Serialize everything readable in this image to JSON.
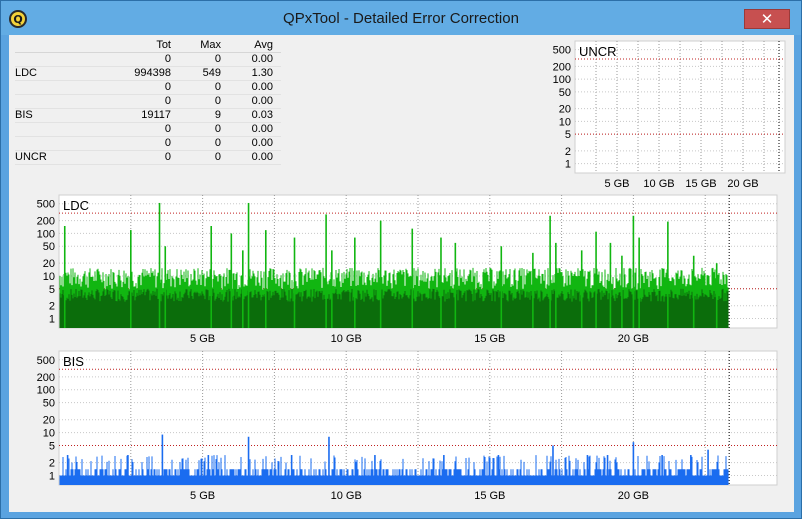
{
  "window": {
    "title": "QPxTool - Detailed Error Correction",
    "close_glyph": "✕",
    "icon": "Q"
  },
  "stats": {
    "headers": {
      "name": "",
      "tot": "Tot",
      "max": "Max",
      "avg": "Avg"
    },
    "rows": [
      {
        "name": "",
        "tot": "0",
        "max": "0",
        "avg": "0.00"
      },
      {
        "name": "LDC",
        "tot": "994398",
        "max": "549",
        "avg": "1.30"
      },
      {
        "name": "",
        "tot": "0",
        "max": "0",
        "avg": "0.00"
      },
      {
        "name": "",
        "tot": "0",
        "max": "0",
        "avg": "0.00"
      },
      {
        "name": "BIS",
        "tot": "19117",
        "max": "9",
        "avg": "0.03"
      },
      {
        "name": "",
        "tot": "0",
        "max": "0",
        "avg": "0.00"
      },
      {
        "name": "",
        "tot": "0",
        "max": "0",
        "avg": "0.00"
      },
      {
        "name": "UNCR",
        "tot": "0",
        "max": "0",
        "avg": "0.00"
      }
    ]
  },
  "chart_data": [
    {
      "type": "bar",
      "title": "UNCR",
      "scale": "log",
      "y_ticks": [
        "500",
        "200",
        "100",
        "50",
        "20",
        "10",
        "5",
        "2",
        "1"
      ],
      "x_ticks": [
        "5 GB",
        "10 GB",
        "15 GB",
        "20 GB"
      ],
      "xlim": [
        0,
        25
      ],
      "threshold_lines": [
        300,
        5
      ],
      "grid": true,
      "series": [
        {
          "color": "#0aa000",
          "values": []
        }
      ]
    },
    {
      "type": "bar",
      "title": "LDC",
      "scale": "log",
      "y_ticks": [
        "500",
        "200",
        "100",
        "50",
        "20",
        "10",
        "5",
        "2",
        "1"
      ],
      "x_ticks": [
        "5 GB",
        "10 GB",
        "15 GB",
        "20 GB"
      ],
      "xlim": [
        0,
        25
      ],
      "data_end_gb": 23.3,
      "threshold_lines": [
        300,
        5
      ],
      "grid": true,
      "typical_level": 12,
      "colors": {
        "bars": "#11b611",
        "inner": "#0b6d0b"
      },
      "spikes": [
        [
          0.2,
          150
        ],
        [
          2.5,
          120
        ],
        [
          3.5,
          520
        ],
        [
          3.7,
          50
        ],
        [
          5.3,
          150
        ],
        [
          6.0,
          100
        ],
        [
          6.4,
          40
        ],
        [
          6.6,
          520
        ],
        [
          7.2,
          120
        ],
        [
          8.2,
          80
        ],
        [
          9.3,
          280
        ],
        [
          9.5,
          40
        ],
        [
          10.3,
          80
        ],
        [
          11.2,
          200
        ],
        [
          12.3,
          130
        ],
        [
          13.3,
          80
        ],
        [
          13.8,
          60
        ],
        [
          15.4,
          50
        ],
        [
          16.5,
          35
        ],
        [
          17.1,
          260
        ],
        [
          17.3,
          60
        ],
        [
          18.2,
          40
        ],
        [
          18.7,
          110
        ],
        [
          19.2,
          60
        ],
        [
          19.6,
          30
        ],
        [
          20.0,
          260
        ],
        [
          20.2,
          80
        ],
        [
          21.2,
          190
        ],
        [
          22.1,
          30
        ],
        [
          22.9,
          20
        ]
      ]
    },
    {
      "type": "bar",
      "title": "BIS",
      "scale": "log",
      "y_ticks": [
        "500",
        "200",
        "100",
        "50",
        "20",
        "10",
        "5",
        "2",
        "1"
      ],
      "x_ticks": [
        "5 GB",
        "10 GB",
        "15 GB",
        "20 GB"
      ],
      "xlim": [
        0,
        25
      ],
      "data_end_gb": 23.3,
      "threshold_lines": [
        300,
        5
      ],
      "grid": true,
      "typical_level": 2,
      "colors": {
        "bars": "#1a6cf0"
      },
      "spikes": [
        [
          0.3,
          3
        ],
        [
          2.4,
          3
        ],
        [
          3.6,
          9
        ],
        [
          5.2,
          3
        ],
        [
          6.6,
          8
        ],
        [
          8.1,
          3
        ],
        [
          9.4,
          8
        ],
        [
          11.0,
          3
        ],
        [
          13.4,
          3
        ],
        [
          15.3,
          3
        ],
        [
          17.2,
          5
        ],
        [
          18.4,
          3
        ],
        [
          19.1,
          3
        ],
        [
          20.0,
          6
        ],
        [
          21.0,
          3
        ],
        [
          22.0,
          3
        ],
        [
          22.6,
          4
        ]
      ]
    }
  ]
}
